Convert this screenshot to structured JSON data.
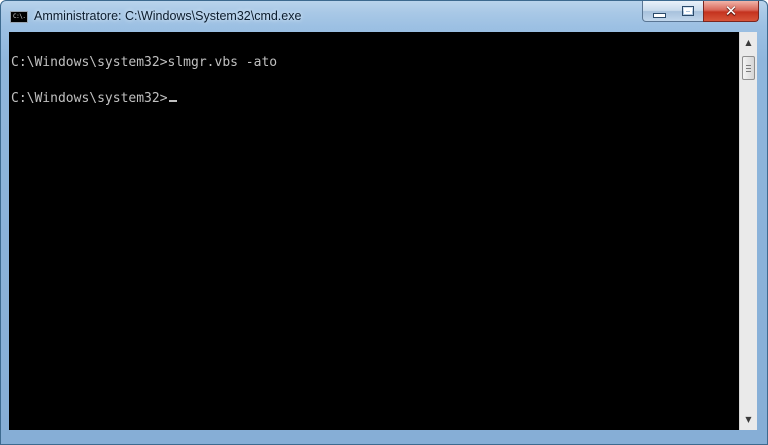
{
  "window": {
    "title": "Amministratore: C:\\Windows\\System32\\cmd.exe",
    "icon": "cmd-icon",
    "icon_text": "C:\\."
  },
  "controls": {
    "minimize_icon": "minimize-icon",
    "maximize_icon": "maximize-icon",
    "close_icon": "close-icon",
    "close_glyph": "✕"
  },
  "console": {
    "background": "#000000",
    "text_color": "#c0c0c0",
    "lines": [
      "C:\\Windows\\system32>slmgr.vbs -ato",
      "C:\\Windows\\system32>"
    ]
  },
  "scrollbar": {
    "up_arrow": "▲",
    "down_arrow": "▼"
  }
}
